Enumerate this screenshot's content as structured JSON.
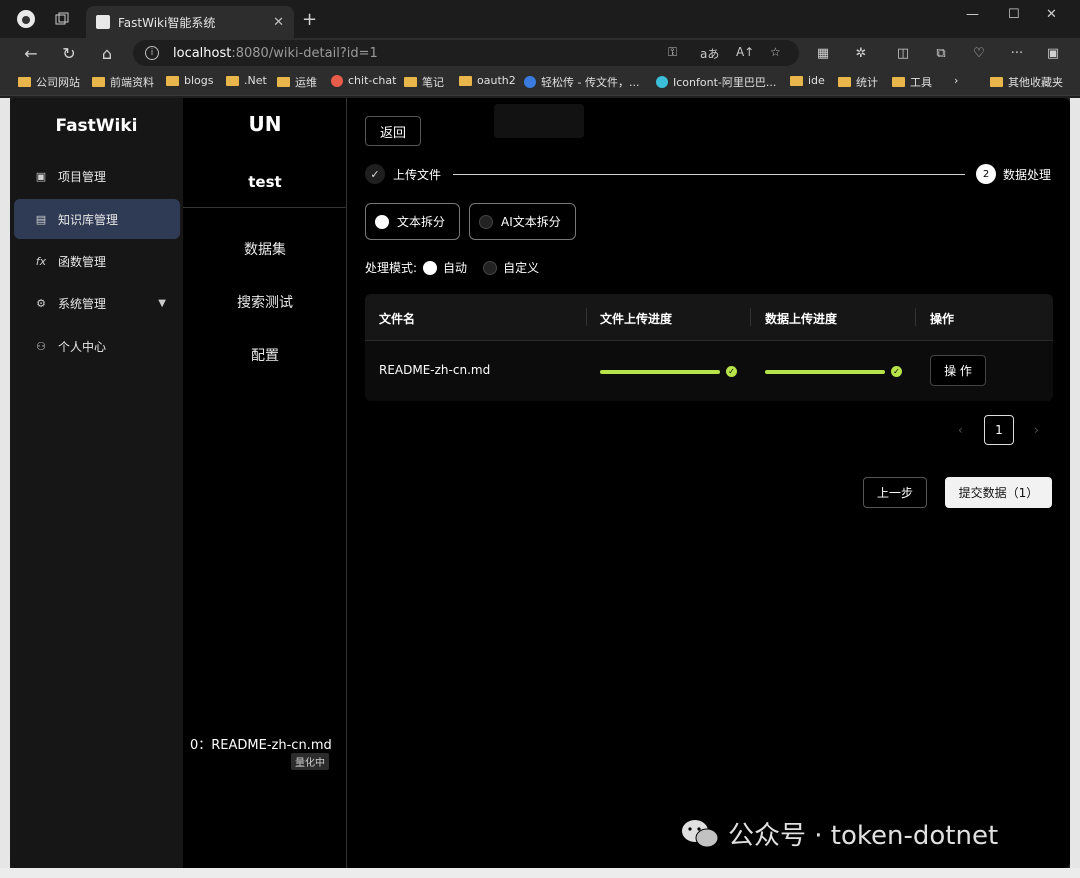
{
  "browser": {
    "tab_title": "FastWiki智能系统",
    "url_host": "localhost",
    "url_path": ":8080/wiki-detail?id=1",
    "bookmarks": [
      "公司网站",
      "前端资料",
      "blogs",
      ".Net",
      "运维",
      "chit-chat",
      "笔记",
      "oauth2",
      "轻松传 - 传文件，...",
      "Iconfont-阿里巴巴...",
      "ide",
      "统计",
      "工具",
      "其他收藏夹"
    ]
  },
  "sidebar": {
    "brand": "FastWiki",
    "items": [
      {
        "label": "项目管理",
        "icon": "project-icon"
      },
      {
        "label": "知识库管理",
        "icon": "knowledge-icon"
      },
      {
        "label": "函数管理",
        "icon": "function-icon"
      },
      {
        "label": "系统管理",
        "icon": "settings-icon"
      },
      {
        "label": "个人中心",
        "icon": "user-icon"
      }
    ],
    "icons": {
      "project": "▣",
      "knowledge": "▤",
      "function": "fx",
      "settings": "⚙",
      "user": "⚇"
    }
  },
  "wiki_panel": {
    "title": "UN",
    "name": "test",
    "menu": [
      "数据集",
      "搜索测试",
      "配置"
    ],
    "file_status": "0：README-zh-cn.md",
    "file_badge": "量化中"
  },
  "main": {
    "back_label": "返回",
    "steps": [
      {
        "label": "上传文件",
        "icon": "✓"
      },
      {
        "label": "数据处理",
        "icon": "2"
      }
    ],
    "split_modes": [
      {
        "label": "文本拆分",
        "selected": true
      },
      {
        "label": "AI文本拆分",
        "selected": false
      }
    ],
    "process_mode_label": "处理模式:",
    "process_modes": [
      {
        "label": "自动",
        "selected": true
      },
      {
        "label": "自定义",
        "selected": false
      }
    ],
    "table": {
      "headers": [
        "文件名",
        "文件上传进度",
        "数据上传进度",
        "操作"
      ],
      "rows": [
        {
          "filename": "README-zh-cn.md",
          "file_progress": 100,
          "data_progress": 100,
          "action": "操 作"
        }
      ]
    },
    "pagination": {
      "current_page": "1",
      "prev": "‹",
      "next": "›"
    },
    "prev_step_label": "上一步",
    "submit_label": "提交数据（1）"
  },
  "watermark": "公众号 · token-dotnet",
  "colors": {
    "accent": "#b7e34b",
    "active_menu": "#2f3a55"
  }
}
